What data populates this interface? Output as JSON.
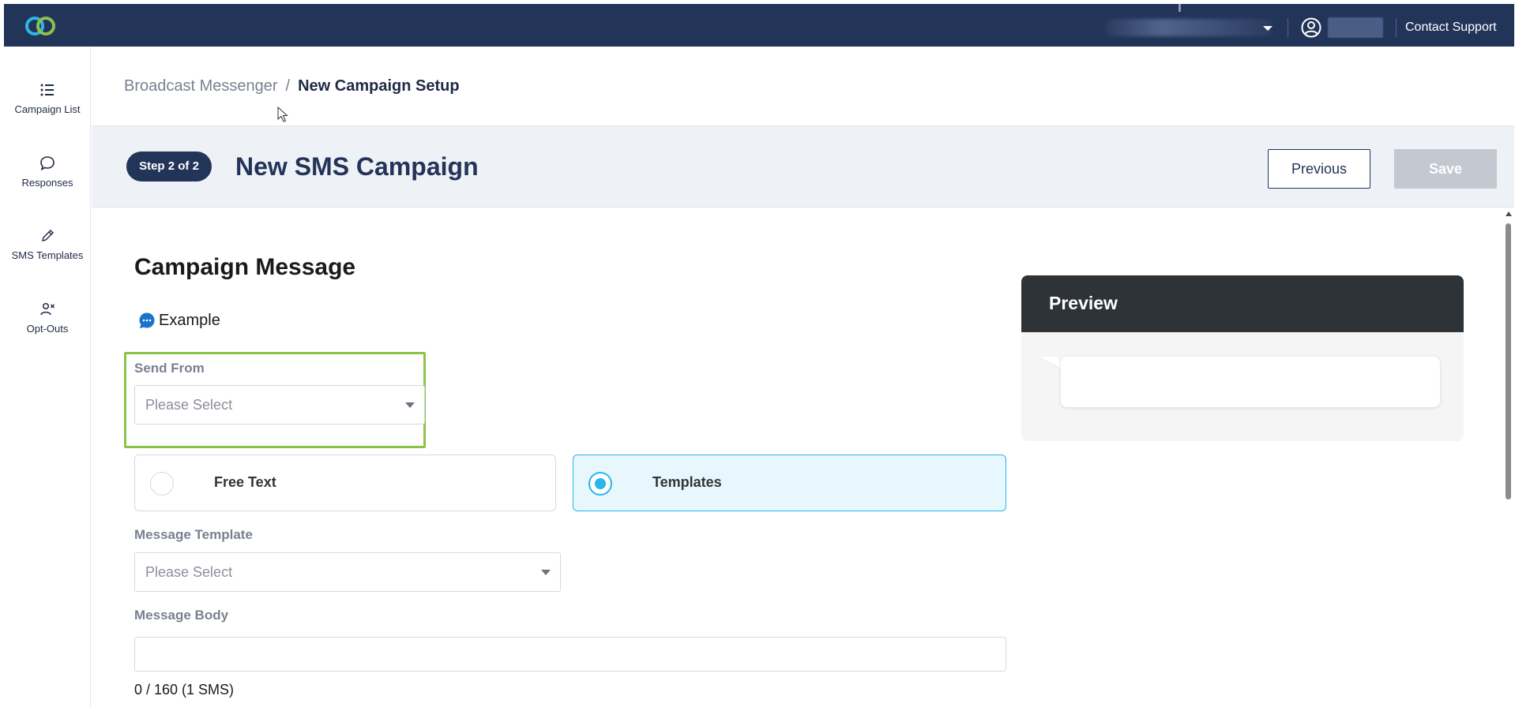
{
  "topbar": {
    "contact_support": "Contact Support"
  },
  "sidebar": {
    "items": [
      {
        "label": "Campaign List",
        "icon": "list-icon"
      },
      {
        "label": "Responses",
        "icon": "chat-bubble-icon"
      },
      {
        "label": "SMS Templates",
        "icon": "pencil-icon"
      },
      {
        "label": "Opt-Outs",
        "icon": "user-remove-icon"
      }
    ]
  },
  "breadcrumb": {
    "parent": "Broadcast Messenger",
    "separator": "/",
    "current": "New Campaign Setup"
  },
  "step": {
    "badge": "Step 2 of 2",
    "title": "New SMS Campaign",
    "previous_label": "Previous",
    "save_label": "Save"
  },
  "form": {
    "section_title": "Campaign Message",
    "example_label": "Example",
    "send_from": {
      "label": "Send From",
      "placeholder": "Please Select"
    },
    "message_type": {
      "options": [
        {
          "label": "Free Text",
          "selected": false
        },
        {
          "label": "Templates",
          "selected": true
        }
      ]
    },
    "message_template": {
      "label": "Message Template",
      "placeholder": "Please Select"
    },
    "message_body": {
      "label": "Message Body",
      "value": "",
      "counter": "0 / 160 (1 SMS)"
    }
  },
  "preview": {
    "title": "Preview",
    "message": ""
  },
  "colors": {
    "navy": "#233459",
    "accent": "#29b6e8",
    "highlight": "#8bc34a",
    "disabled": "#c3c8d1"
  }
}
